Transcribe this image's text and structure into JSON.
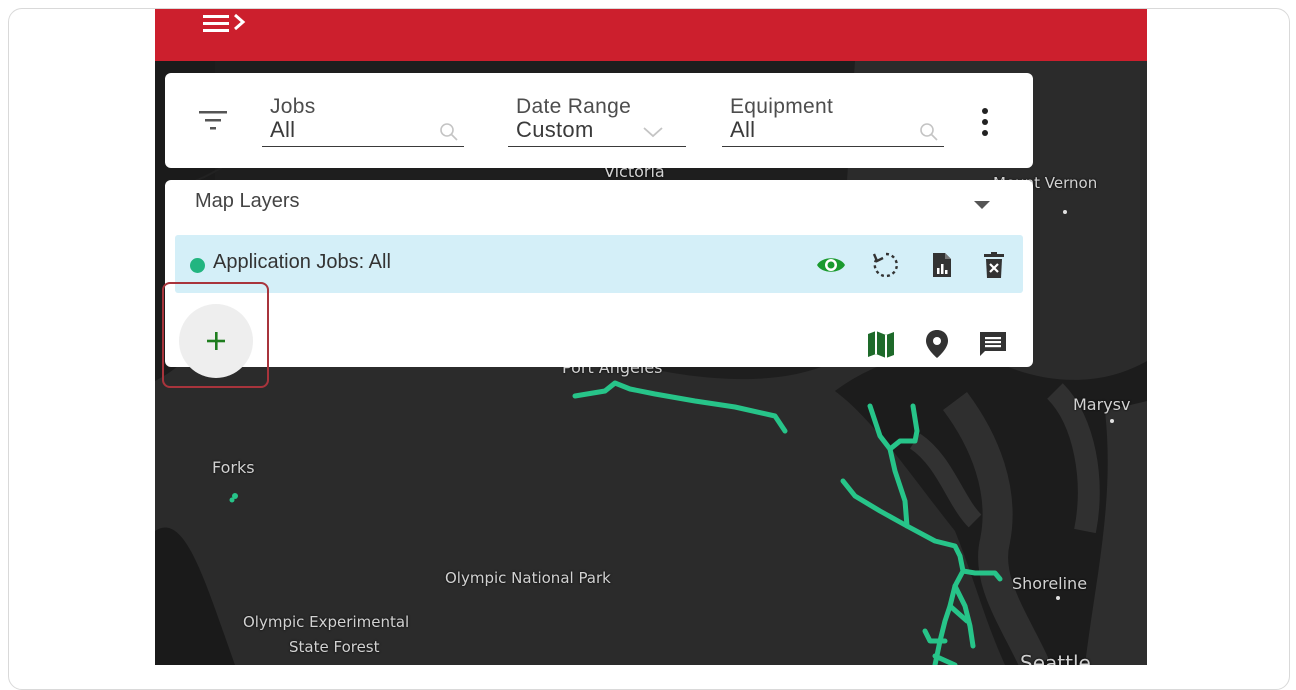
{
  "filters": {
    "jobs": {
      "label": "Jobs",
      "value": "All"
    },
    "date_range": {
      "label": "Date Range",
      "value": "Custom"
    },
    "equipment": {
      "label": "Equipment",
      "value": "All"
    }
  },
  "layers": {
    "title": "Map Layers",
    "items": [
      {
        "label": "Application Jobs: All",
        "dot_color": "#22b580"
      }
    ]
  },
  "map": {
    "labels": [
      "Victoria",
      "Mount Vernon",
      "Port Angeles",
      "Marysv",
      "Forks",
      "Olympic National Park",
      "Shoreline",
      "Olympic Experimental",
      "State Forest",
      "Seattle"
    ],
    "track_color": "#27c489"
  },
  "colors": {
    "brand_red": "#cc1f2d",
    "accent_green": "#1e7d1e",
    "eye_green": "#1a9a2e",
    "layer_highlight": "#d4eff8",
    "map_background": "#262626"
  },
  "icons": {
    "menu": "menu-expand-icon",
    "filter": "filter-icon",
    "search": "search-icon",
    "chevron": "chevron-down-icon",
    "more": "more-vert-icon",
    "visibility": "eye-icon",
    "refresh": "refresh-icon",
    "report": "report-icon",
    "delete": "delete-icon",
    "add": "plus-icon",
    "map": "map-icon",
    "pin": "location-pin-icon",
    "comment": "comment-icon"
  }
}
